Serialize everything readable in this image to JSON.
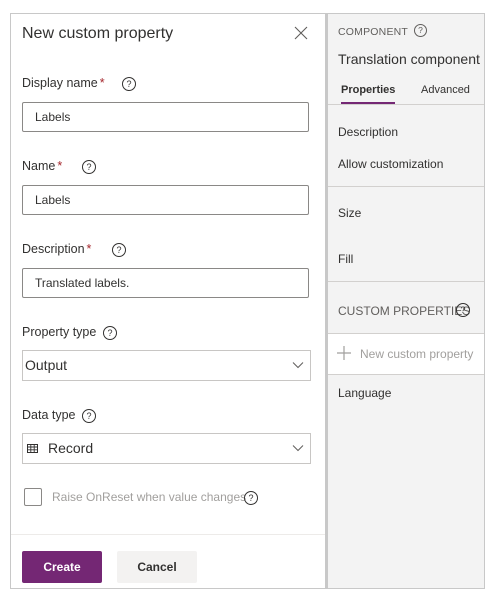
{
  "dialog": {
    "title": "New custom property",
    "close_icon": "close-icon",
    "fields": {
      "display_name": {
        "label": "Display name",
        "required_mark": "*",
        "value": "Labels"
      },
      "name": {
        "label": "Name",
        "required_mark": "*",
        "value": "Labels"
      },
      "description": {
        "label": "Description",
        "required_mark": "*",
        "value": "Translated labels."
      },
      "property_type": {
        "label": "Property type",
        "selected": "Output"
      },
      "data_type": {
        "label": "Data type",
        "selected": "Record",
        "icon": "table-icon"
      }
    },
    "help_glyph": "?",
    "raise_onreset": {
      "label": "Raise OnReset when value changes",
      "checked": false
    },
    "buttons": {
      "create": "Create",
      "cancel": "Cancel"
    },
    "accent_color": "#742774"
  },
  "side_panel": {
    "caption": "COMPONENT",
    "title": "Translation component",
    "tabs": [
      {
        "label": "Properties",
        "active": true
      },
      {
        "label": "Advanced",
        "active": false
      }
    ],
    "properties": [
      "Description",
      "Allow customization",
      "Size",
      "Fill"
    ],
    "custom_properties": {
      "caption": "CUSTOM PROPERTIES",
      "new_label": "New custom property",
      "items": [
        "Language"
      ]
    }
  }
}
